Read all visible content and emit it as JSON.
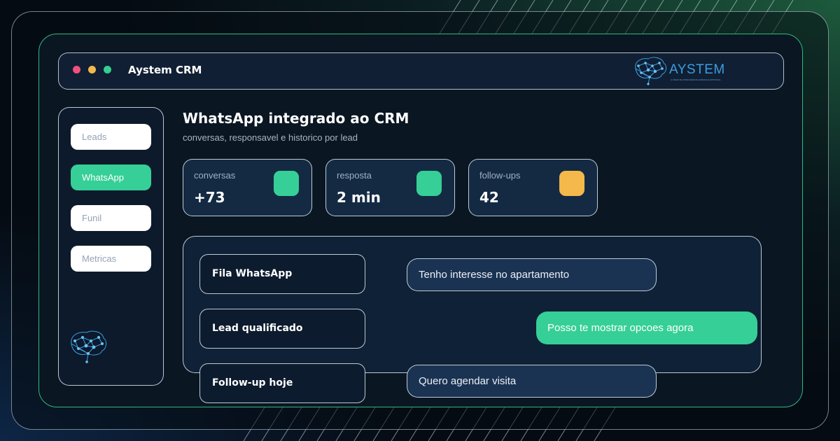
{
  "window": {
    "title": "Aystem CRM",
    "brand": "AYSTEM",
    "brand_tagline": "A UNIAO DA INTELIGENCIA HUMANA E ARTIFICIAL"
  },
  "sidebar": {
    "items": [
      {
        "label": "Leads",
        "active": false
      },
      {
        "label": "WhatsApp",
        "active": true
      },
      {
        "label": "Funil",
        "active": false
      },
      {
        "label": "Metricas",
        "active": false
      }
    ]
  },
  "header": {
    "title": "WhatsApp integrado ao CRM",
    "subtitle": "conversas, responsavel e historico por lead"
  },
  "stats": [
    {
      "label": "conversas",
      "value": "+73",
      "color": "#36cf97"
    },
    {
      "label": "resposta",
      "value": "2 min",
      "color": "#36cf97"
    },
    {
      "label": "follow-ups",
      "value": "42",
      "color": "#f5b84a"
    }
  ],
  "queue": [
    {
      "label": "Fila WhatsApp"
    },
    {
      "label": "Lead qualificado"
    },
    {
      "label": "Follow-up hoje"
    }
  ],
  "messages": [
    {
      "text": "Tenho interesse no apartamento",
      "direction": "incoming"
    },
    {
      "text": "Posso te mostrar opcoes agora",
      "direction": "outgoing"
    },
    {
      "text": "Quero agendar visita",
      "direction": "incoming"
    }
  ],
  "colors": {
    "accent": "#36cf97",
    "warning": "#f5b84a",
    "dot_red": "#f0507e",
    "dot_yellow": "#f2b84b",
    "dot_green": "#36cf8f",
    "brand_blue": "#3a9ee0"
  },
  "icons": [
    "close-dot-icon",
    "minimize-dot-icon",
    "maximize-dot-icon",
    "brain-network-logo-icon"
  ]
}
